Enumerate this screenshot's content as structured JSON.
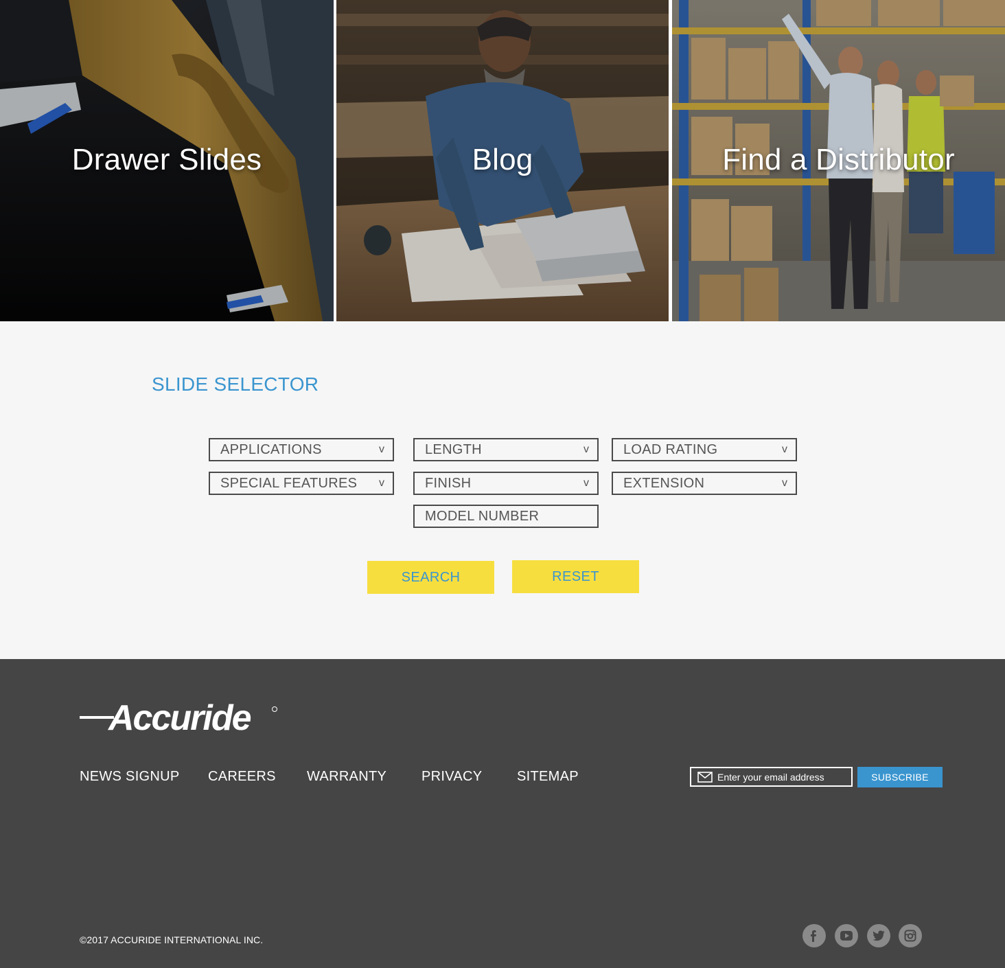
{
  "tiles": [
    {
      "label": "Drawer Slides",
      "image": "drawer-slides-photo"
    },
    {
      "label": "Blog",
      "image": "craftsman-at-desk-photo"
    },
    {
      "label": "Find a Distributor",
      "image": "warehouse-photo"
    }
  ],
  "selector": {
    "title": "SLIDE SELECTOR",
    "fields": {
      "applications": "APPLICATIONS",
      "length": "LENGTH",
      "load_rating": "LOAD RATING",
      "special_features": "SPECIAL FEATURES",
      "finish": "FINISH",
      "extension": "EXTENSION",
      "model_number": "MODEL NUMBER"
    },
    "chevron": "v",
    "search_label": "SEARCH",
    "reset_label": "RESET"
  },
  "footer": {
    "logo_text": "Accuride",
    "nav": [
      "NEWS SIGNUP",
      "CAREERS",
      "WARRANTY",
      "PRIVACY",
      "SITEMAP"
    ],
    "email_placeholder": "Enter your email address",
    "subscribe_label": "SUBSCRIBE",
    "copyright": "©2017 ACCURIDE INTERNATIONAL INC.",
    "social": [
      "facebook-icon",
      "youtube-icon",
      "twitter-icon",
      "instagram-icon"
    ]
  },
  "colors": {
    "accent_blue": "#3a95cf",
    "button_yellow": "#f7de3f",
    "footer_bg": "#454545",
    "section_bg": "#f6f6f6"
  }
}
